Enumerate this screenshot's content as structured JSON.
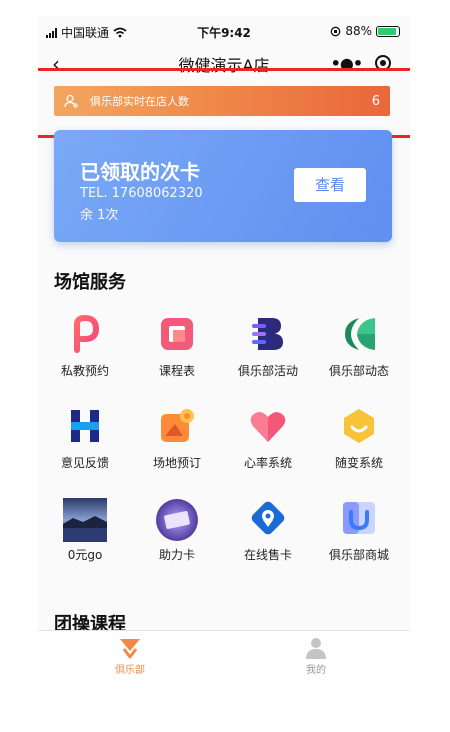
{
  "status_bar": {
    "carrier": "中国联通",
    "time": "下午9:42",
    "battery": "88%"
  },
  "nav": {
    "title": "微健演示A店"
  },
  "member_bar": {
    "label": "俱乐部实时在店人数",
    "count": "6"
  },
  "card": {
    "title": "已领取的次卡",
    "tel": "TEL. 17608062320",
    "remaining": "余 1次",
    "view_label": "查看"
  },
  "services": {
    "title": "场馆服务",
    "items": [
      {
        "label": "私教预约",
        "icon": "p-logo-icon"
      },
      {
        "label": "课程表",
        "icon": "calendar-icon"
      },
      {
        "label": "俱乐部活动",
        "icon": "b-logo-icon"
      },
      {
        "label": "俱乐部动态",
        "icon": "k-leaf-icon"
      },
      {
        "label": "意见反馈",
        "icon": "h-logo-icon"
      },
      {
        "label": "场地预订",
        "icon": "venue-icon"
      },
      {
        "label": "心率系统",
        "icon": "heart-icon"
      },
      {
        "label": "随变系统",
        "icon": "smile-hexagon-icon"
      },
      {
        "label": "0元go",
        "icon": "landscape-photo"
      },
      {
        "label": "助力卡",
        "icon": "card-photo"
      },
      {
        "label": "在线售卡",
        "icon": "pin-card-icon"
      },
      {
        "label": "俱乐部商城",
        "icon": "shop-icon"
      }
    ]
  },
  "group_courses": {
    "title": "团操课程"
  },
  "tabbar": {
    "items": [
      {
        "label": "俱乐部",
        "active": true
      },
      {
        "label": "我的",
        "active": false
      }
    ]
  },
  "colors": {
    "accent_orange": "#f08a4a",
    "card_blue": "#6a98f2",
    "highlight_red": "#e8262a"
  }
}
